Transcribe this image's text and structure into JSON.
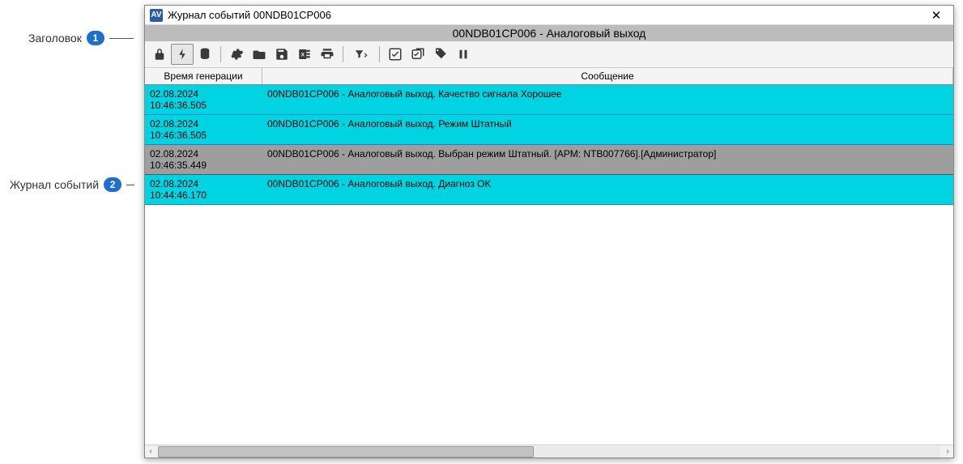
{
  "callouts": {
    "c1": {
      "label": "Заголовок",
      "badge": "1"
    },
    "c2": {
      "label": "Журнал событий",
      "badge": "2"
    }
  },
  "window": {
    "app_icon_text": "AV",
    "title": "Журнал событий 00NDB01CP006",
    "close_symbol": "✕"
  },
  "header_strip": "00NDB01CP006 - Аналоговый выход",
  "columns": {
    "time": "Время генерации",
    "message": "Сообщение"
  },
  "rows": [
    {
      "time": "02.08.2024 10:46:36.505",
      "msg": "00NDB01CP006 - Аналоговый выход. Качество сигнала Хорошее",
      "cls": "bg-cyan"
    },
    {
      "time": "02.08.2024 10:46:36.505",
      "msg": "00NDB01CP006 - Аналоговый выход. Режим Штатный",
      "cls": "bg-cyan"
    },
    {
      "time": "02.08.2024 10:46:35.449",
      "msg": "00NDB01CP006 - Аналоговый выход. Выбран режим Штатный. [АРМ: NTB007766].[Администратор]",
      "cls": "bg-grey sel"
    },
    {
      "time": "02.08.2024 10:44:46.170",
      "msg": "00NDB01CP006 - Аналоговый выход. Диагноз OK",
      "cls": "bg-cyan"
    }
  ],
  "scroll": {
    "left_arrow": "‹",
    "right_arrow": "›"
  }
}
